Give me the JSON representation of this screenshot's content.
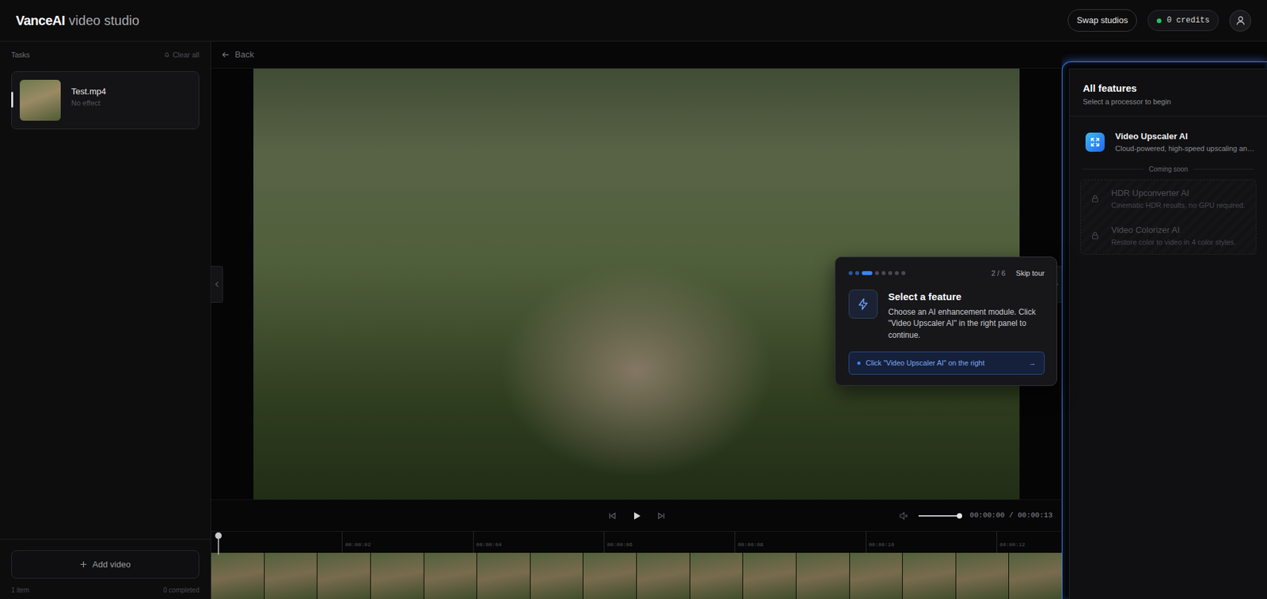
{
  "header": {
    "logo_bold": "VanceAI",
    "logo_light": "video studio",
    "swap_button": "Swap studios",
    "credits": "0 credits"
  },
  "sidebar": {
    "title": "Tasks",
    "clear": "Clear all",
    "tasks": [
      {
        "name": "Test.mp4",
        "effect": "No effect",
        "selected": true
      }
    ],
    "add": "Add video",
    "footer_left": "1 item",
    "footer_right": "0 completed"
  },
  "toolbar": {
    "back": "Back"
  },
  "player": {
    "time": "00:00:00 / 00:00:13",
    "volume_level": 1.0
  },
  "timeline": {
    "ticks": [
      "00:00:02",
      "00:00:04",
      "00:00:06",
      "00:00:08",
      "00:00:10",
      "00:00:12"
    ],
    "total_seconds": 13,
    "playhead_level": 0
  },
  "features": {
    "title": "All features",
    "subtitle": "Select a processor to begin",
    "items": [
      {
        "name": "Video Upscaler AI",
        "description": "Cloud-powered, high-speed upscaling an…",
        "locked": false
      }
    ],
    "coming_soon_label": "Coming soon",
    "coming_soon": [
      {
        "name": "HDR Upconverter AI",
        "description": "Cinematic HDR results, no GPU required.",
        "locked": true
      },
      {
        "name": "Video Colorizer AI",
        "description": "Restore color to video in 4 color styles.",
        "locked": true
      }
    ]
  },
  "tour": {
    "dots": [
      {
        "selected": false,
        "done": true
      },
      {
        "selected": false,
        "done": true
      },
      {
        "selected": true,
        "done": false
      },
      {
        "selected": false,
        "done": false
      },
      {
        "selected": false,
        "done": false
      },
      {
        "selected": false,
        "done": false
      },
      {
        "selected": false,
        "done": false
      },
      {
        "selected": false,
        "done": false
      }
    ],
    "progress": "2 / 6",
    "skip": "Skip tour",
    "title": "Select a feature",
    "body": "Choose an AI enhancement module. Click \"Video Upscaler AI\" in the right panel to continue.",
    "cta": "Click \"Video Upscaler AI\" on the right",
    "cta_arrow": "→"
  }
}
